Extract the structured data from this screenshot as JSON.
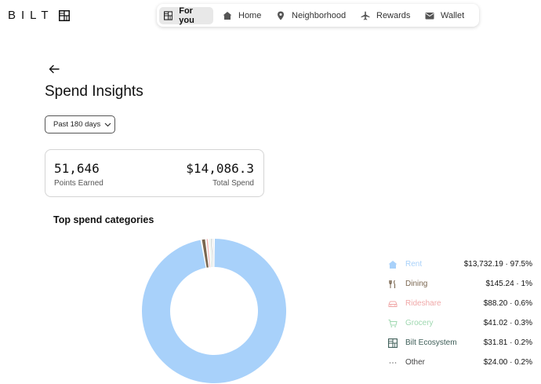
{
  "brand": {
    "name": "BILT"
  },
  "nav": {
    "items": [
      {
        "label": "For you",
        "icon": "grid-icon",
        "active": true
      },
      {
        "label": "Home",
        "icon": "house-icon",
        "active": false
      },
      {
        "label": "Neighborhood",
        "icon": "map-pin-icon",
        "active": false
      },
      {
        "label": "Rewards",
        "icon": "airplane-icon",
        "active": false
      },
      {
        "label": "Wallet",
        "icon": "envelope-icon",
        "active": false
      }
    ]
  },
  "page": {
    "title": "Spend Insights",
    "period_label": "Past 180 days"
  },
  "stats": {
    "points_value": "51,646",
    "points_label": "Points Earned",
    "spend_value": "$14,086.3",
    "spend_label": "Total Spend"
  },
  "categories_title": "Top spend categories",
  "chart_data": {
    "type": "pie",
    "categories": [
      "Rent",
      "Dining",
      "Rideshare",
      "Grocery",
      "Bilt Ecosystem",
      "Other"
    ],
    "values": [
      13732.19,
      145.24,
      88.2,
      41.02,
      31.81,
      24.0
    ],
    "percents": [
      97.5,
      1,
      0.6,
      0.3,
      0.2,
      0.2
    ],
    "colors": [
      "#a8d1fa",
      "#7a6650",
      "#f3b8b8",
      "#a9dcb9",
      "#3c5c56",
      "#9aa0a6"
    ]
  },
  "legend": [
    {
      "name": "Rent",
      "value": "$13,732.19 · 97.5%",
      "color": "#a8d1fa",
      "icon": "house-icon"
    },
    {
      "name": "Dining",
      "value": "$145.24 · 1%",
      "color": "#7a6650",
      "icon": "fork-knife-icon"
    },
    {
      "name": "Rideshare",
      "value": "$88.20 · 0.6%",
      "color": "#f0a8a8",
      "icon": "car-icon"
    },
    {
      "name": "Grocery",
      "value": "$41.02 · 0.3%",
      "color": "#9fd8b0",
      "icon": "cart-icon"
    },
    {
      "name": "Bilt Ecosystem",
      "value": "$31.81 · 0.2%",
      "color": "#3c5c56",
      "icon": "grid-icon"
    },
    {
      "name": "Other",
      "value": "$24.00 · 0.2%",
      "color": "#555555",
      "icon": "ellipsis-icon"
    }
  ]
}
